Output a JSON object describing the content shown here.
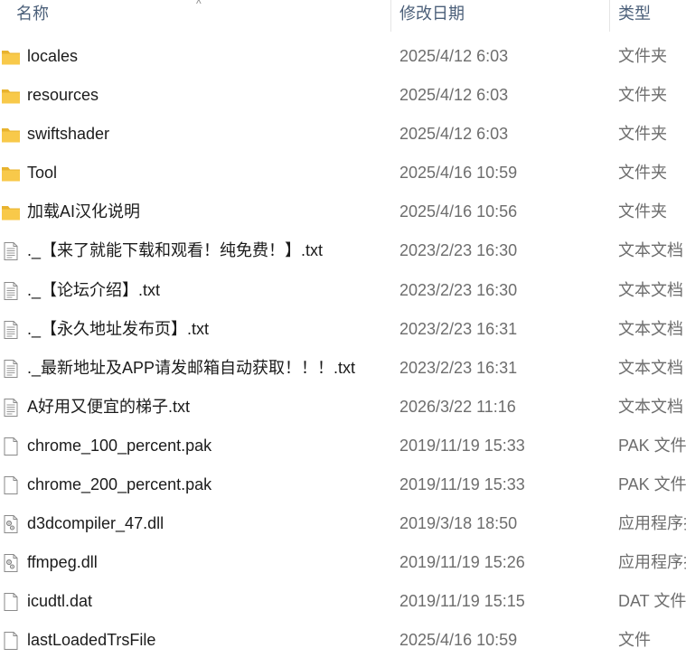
{
  "header": {
    "name_label": "名称",
    "date_label": "修改日期",
    "type_label": "类型",
    "sort_glyph": "^"
  },
  "files": [
    {
      "name": "locales",
      "date": "2025/4/12 6:03",
      "type": "文件夹",
      "icon": "folder-icon"
    },
    {
      "name": "resources",
      "date": "2025/4/12 6:03",
      "type": "文件夹",
      "icon": "folder-icon"
    },
    {
      "name": "swiftshader",
      "date": "2025/4/12 6:03",
      "type": "文件夹",
      "icon": "folder-icon"
    },
    {
      "name": "Tool",
      "date": "2025/4/16 10:59",
      "type": "文件夹",
      "icon": "folder-icon"
    },
    {
      "name": "加载AI汉化说明",
      "date": "2025/4/16 10:56",
      "type": "文件夹",
      "icon": "folder-icon"
    },
    {
      "name": "._【来了就能下载和观看！纯免费！】.txt",
      "date": "2023/2/23 16:30",
      "type": "文本文档",
      "icon": "text-file-icon"
    },
    {
      "name": "._【论坛介绍】.txt",
      "date": "2023/2/23 16:30",
      "type": "文本文档",
      "icon": "text-file-icon"
    },
    {
      "name": "._【永久地址发布页】.txt",
      "date": "2023/2/23 16:31",
      "type": "文本文档",
      "icon": "text-file-icon"
    },
    {
      "name": "._最新地址及APP请发邮箱自动获取！！！.txt",
      "date": "2023/2/23 16:31",
      "type": "文本文档",
      "icon": "text-file-icon"
    },
    {
      "name": "A好用又便宜的梯子.txt",
      "date": "2026/3/22 11:16",
      "type": "文本文档",
      "icon": "text-file-icon"
    },
    {
      "name": "chrome_100_percent.pak",
      "date": "2019/11/19 15:33",
      "type": "PAK 文件",
      "icon": "blank-file-icon"
    },
    {
      "name": "chrome_200_percent.pak",
      "date": "2019/11/19 15:33",
      "type": "PAK 文件",
      "icon": "blank-file-icon"
    },
    {
      "name": "d3dcompiler_47.dll",
      "date": "2019/3/18 18:50",
      "type": "应用程序扩展",
      "icon": "dll-file-icon"
    },
    {
      "name": "ffmpeg.dll",
      "date": "2019/11/19 15:26",
      "type": "应用程序扩展",
      "icon": "dll-file-icon"
    },
    {
      "name": "icudtl.dat",
      "date": "2019/11/19 15:15",
      "type": "DAT 文件",
      "icon": "blank-file-icon"
    },
    {
      "name": "lastLoadedTrsFile",
      "date": "2025/4/16 10:59",
      "type": "文件",
      "icon": "blank-file-icon"
    }
  ],
  "colors": {
    "folder": "#f8c94a",
    "folder_tab": "#e8b32f",
    "header_text": "#4c607a",
    "name_text": "#1b1b1b",
    "meta_text": "#6d6d6d"
  }
}
